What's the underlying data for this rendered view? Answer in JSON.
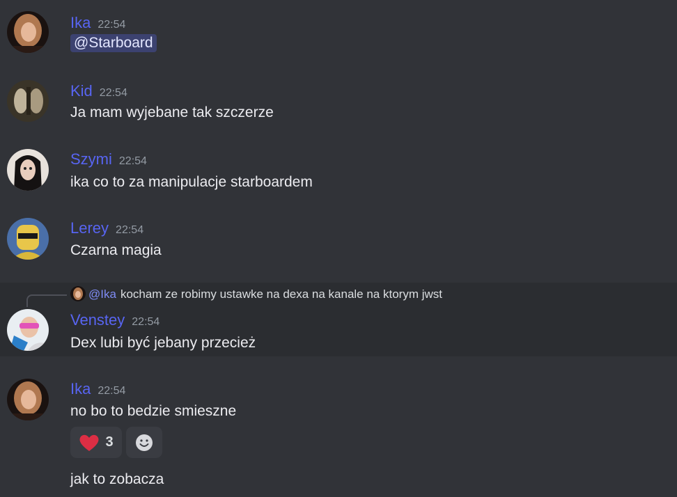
{
  "messages": [
    {
      "username": "Ika",
      "time": "22:54",
      "mention": "@Starboard"
    },
    {
      "username": "Kid",
      "time": "22:54",
      "text": "Ja mam wyjebane tak szczerze"
    },
    {
      "username": "Szymi",
      "time": "22:54",
      "text": "ika co to za manipulacje starboardem"
    },
    {
      "username": "Lerey",
      "time": "22:54",
      "text": "Czarna magia"
    },
    {
      "username": "Venstey",
      "time": "22:54",
      "text": "Dex lubi być jebany przecież",
      "reply": {
        "mention": "@Ika",
        "text": "kocham ze robimy ustawke na dexa na kanale na ktorym jwst"
      }
    },
    {
      "username": "Ika",
      "time": "22:54",
      "text": "no bo to bedzie smieszne",
      "reactions": [
        {
          "icon": "heart-emoji",
          "count": "3"
        },
        {
          "icon": "add-reaction-icon"
        }
      ],
      "followup": "jak to zobacza"
    }
  ],
  "colors": {
    "username": "#5865f2",
    "background": "#313338",
    "highlight": "#2b2d31"
  }
}
